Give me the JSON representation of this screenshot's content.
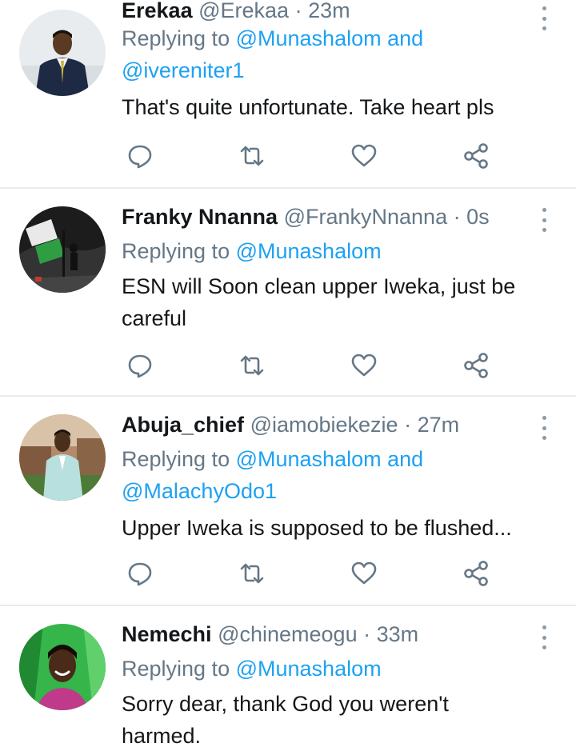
{
  "tweets": [
    {
      "name": "Erekaa",
      "handle": "@Erekaa",
      "time": "23m",
      "replying_prefix": "Replying to",
      "replying_lines": [
        "@Munashalom and",
        "@ivereniter1"
      ],
      "text": "That's quite unfortunate. Take heart pls"
    },
    {
      "name": "Franky Nnanna",
      "handle": "@FrankyNnanna",
      "time": "0s",
      "replying_prefix": "Replying to",
      "replying_lines": [
        "@Munashalom"
      ],
      "text": "ESN will Soon clean upper Iweka, just be careful"
    },
    {
      "name": "Abuja_chief",
      "handle": "@iamobiekezie",
      "time": "27m",
      "replying_prefix": "Replying to",
      "replying_lines": [
        "@Munashalom and",
        "@MalachyOdo1"
      ],
      "text": "Upper Iweka is supposed to be flushed..."
    },
    {
      "name": "Nemechi",
      "handle": "@chinemeogu",
      "time": "33m",
      "replying_prefix": "Replying to",
      "replying_lines": [
        "@Munashalom"
      ],
      "text": "Sorry dear, thank God you weren't harmed."
    }
  ],
  "separator": "·",
  "colors": {
    "accent": "#1da1f2",
    "secondary_text": "#657786",
    "icon": "#657786",
    "divider": "#e6ecf0"
  },
  "icons": {
    "reply": "reply-icon",
    "retweet": "retweet-icon",
    "like": "heart-icon",
    "share": "share-icon",
    "more": "more-vertical-icon"
  }
}
